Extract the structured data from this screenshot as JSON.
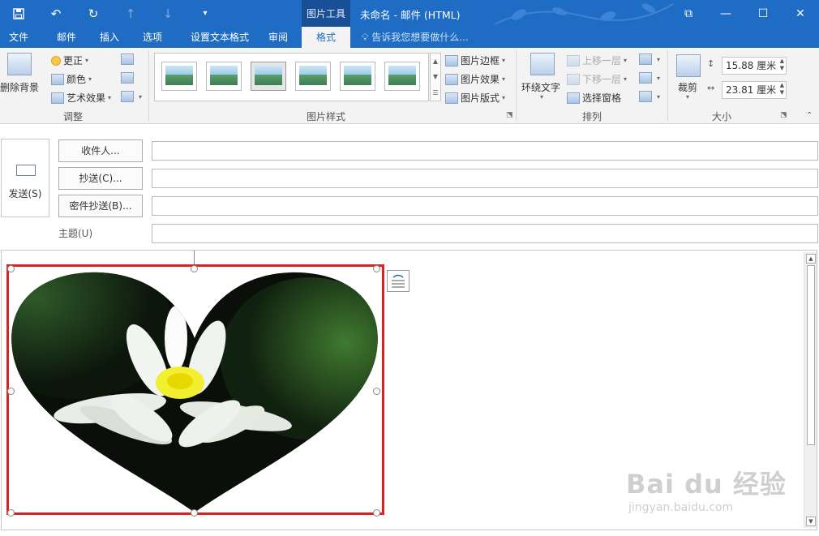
{
  "window": {
    "contextual_tab_label": "图片工具",
    "title": "未命名 - 邮件 (HTML)"
  },
  "tabs": [
    {
      "label": "文件",
      "active": false
    },
    {
      "label": "邮件",
      "active": false
    },
    {
      "label": "插入",
      "active": false
    },
    {
      "label": "选项",
      "active": false
    },
    {
      "label": "设置文本格式",
      "active": false
    },
    {
      "label": "审阅",
      "active": false
    },
    {
      "label": "格式",
      "active": true
    }
  ],
  "tell_me": "告诉我您想要做什么...",
  "ribbon": {
    "remove_background": "删除背景",
    "corrections": "更正",
    "color": "颜色",
    "artistic_effects": "艺术效果",
    "group_adjust": "调整",
    "group_picture_styles": "图片样式",
    "picture_border": "图片边框",
    "picture_effects": "图片效果",
    "picture_layout": "图片版式",
    "wrap_text": "环绕文字",
    "bring_forward": "上移一层",
    "send_backward": "下移一层",
    "selection_pane": "选择窗格",
    "group_arrange": "排列",
    "crop": "裁剪",
    "height": "15.88 厘米",
    "width": "23.81 厘米",
    "group_size": "大小"
  },
  "compose": {
    "send": "发送(S)",
    "to": "收件人...",
    "cc": "抄送(C)...",
    "bcc": "密件抄送(B)...",
    "subject": "主题(U)"
  },
  "watermark": {
    "main": "Bai du 经验",
    "sub": "jingyan.baidu.com"
  }
}
